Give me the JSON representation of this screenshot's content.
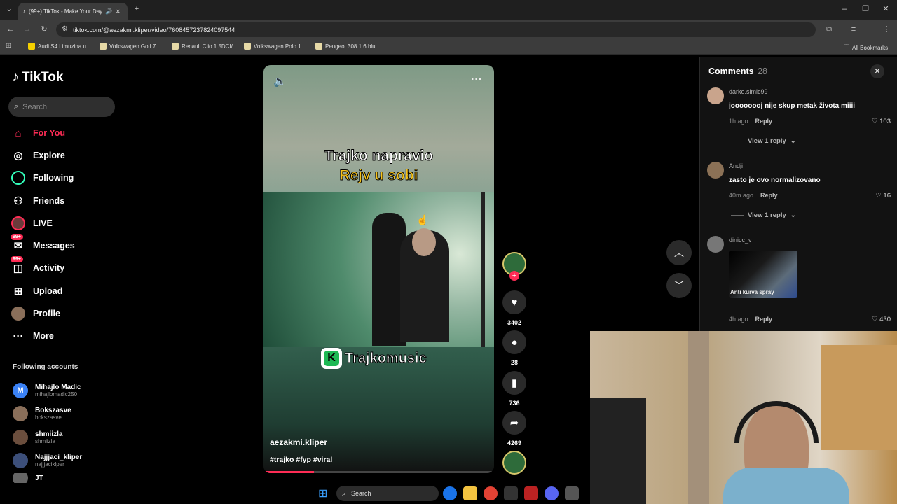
{
  "browser": {
    "tab_title": "(99+) TikTok - Make Your Day",
    "url": "tiktok.com/@aezakmi.kliper/video/7608457237824097544",
    "bookmarks": [
      "Audi S4 Limuzina u...",
      "Volkswagen Golf 7...",
      "Renault Clio 1.5DCI/...",
      "Volkswagen Polo 1....",
      "Peugeot 308 1.6 blu..."
    ],
    "all_bookmarks": "All Bookmarks"
  },
  "sidebar": {
    "logo": "TikTok",
    "search_placeholder": "Search",
    "nav": [
      {
        "label": "For You",
        "icon": "home-icon",
        "active": true
      },
      {
        "label": "Explore",
        "icon": "compass-icon"
      },
      {
        "label": "Following",
        "icon": "following-icon"
      },
      {
        "label": "Friends",
        "icon": "friends-icon"
      },
      {
        "label": "LIVE",
        "icon": "live-icon"
      },
      {
        "label": "Messages",
        "icon": "messages-icon",
        "badge": "99+"
      },
      {
        "label": "Activity",
        "icon": "activity-icon",
        "badge": "99+"
      },
      {
        "label": "Upload",
        "icon": "upload-icon"
      },
      {
        "label": "Profile",
        "icon": "profile-icon"
      },
      {
        "label": "More",
        "icon": "more-icon"
      }
    ],
    "following_title": "Following accounts",
    "accounts": [
      {
        "name": "Mihajlo Madic",
        "user": "mihajlomadic250",
        "color": "#3b82f6",
        "initial": "M"
      },
      {
        "name": "Bokszasve",
        "user": "bokszasve",
        "color": "#8a6f5a"
      },
      {
        "name": "shmiizla",
        "user": "shmiizla",
        "color": "#6b4e3d"
      },
      {
        "name": "Najjjaci_kliper",
        "user": "najjjaciklper",
        "color": "#3c4f7a"
      },
      {
        "name": "JT",
        "user": "",
        "color": "#666"
      }
    ]
  },
  "video": {
    "caption_line1": "Trajko napravio",
    "caption_line2": "Rejv u sobi",
    "brand": "Trajkomusic",
    "author": "aezakmi.kliper",
    "tags": "#trajko #fyp #viral",
    "progress": 0.22
  },
  "actions": {
    "likes": "3402",
    "comments": "28",
    "saves": "736",
    "shares": "4269"
  },
  "comments": {
    "title": "Comments",
    "count": "28",
    "items": [
      {
        "user": "darko.simic99",
        "text": "joooooooj nije skup metak života miiii",
        "time": "1h ago",
        "reply": "Reply",
        "likes": "103",
        "view_replies": "View 1 reply"
      },
      {
        "user": "Andji",
        "text": "zasto je ovo normalizovano",
        "time": "40m ago",
        "reply": "Reply",
        "likes": "16",
        "view_replies": "View 1 reply"
      },
      {
        "user": "dinicc_v",
        "sticker_text": "Anti kurva spray",
        "time": "4h ago",
        "reply": "Reply",
        "likes": "430"
      }
    ]
  },
  "taskbar": {
    "search": "Search"
  }
}
